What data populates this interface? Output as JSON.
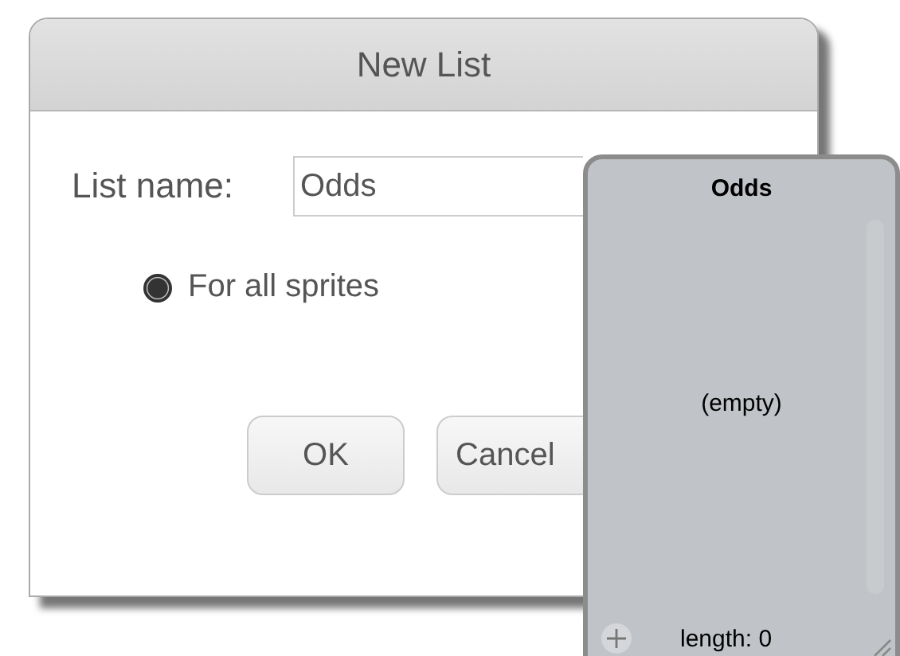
{
  "dialog": {
    "title": "New List",
    "field": {
      "label": "List name:",
      "value": "Odds"
    },
    "options": [
      {
        "label": "For all sprites",
        "selected": true
      }
    ],
    "buttons": [
      {
        "label": "OK"
      },
      {
        "label": "Cancel"
      }
    ]
  },
  "list_monitor": {
    "title": "Odds",
    "empty_text": "(empty)",
    "length": "length: 0"
  }
}
